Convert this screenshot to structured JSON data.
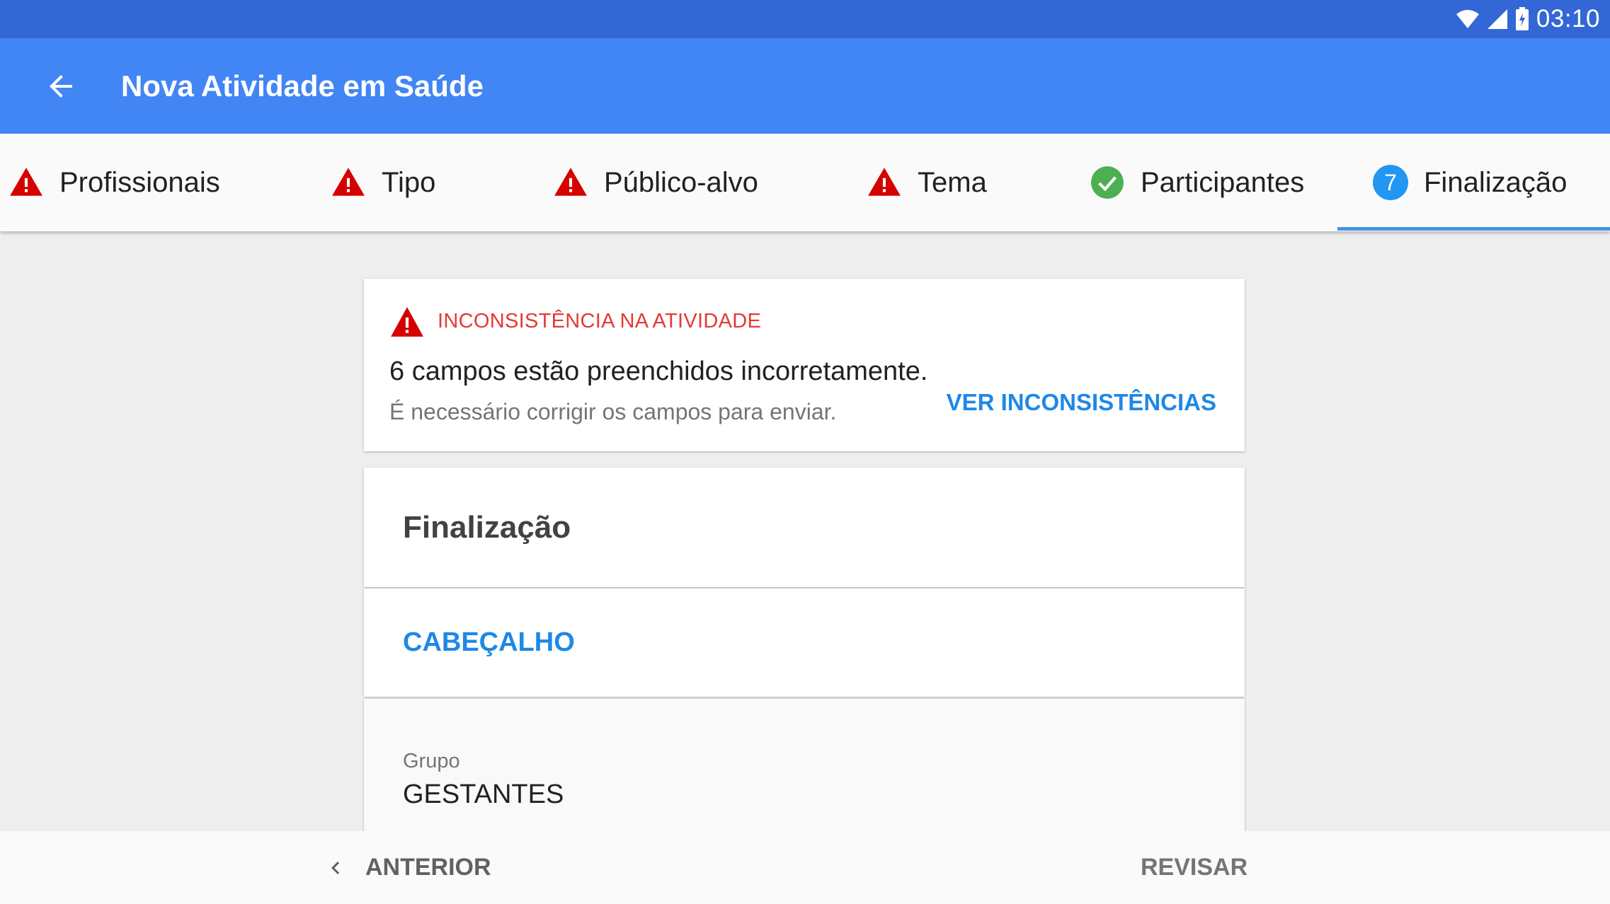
{
  "status_bar": {
    "time": "03:10",
    "icons": [
      "wifi-icon",
      "signal-icon",
      "battery-icon"
    ]
  },
  "app_bar": {
    "title": "Nova Atividade em Saúde",
    "back_icon": "arrow-back-icon"
  },
  "stepper": {
    "active_index": 5,
    "steps": [
      {
        "label": "Profissionais",
        "status": "error",
        "icon": "warning-icon"
      },
      {
        "label": "Tipo",
        "status": "error",
        "icon": "warning-icon"
      },
      {
        "label": "Público-alvo",
        "status": "error",
        "icon": "warning-icon"
      },
      {
        "label": "Tema",
        "status": "error",
        "icon": "warning-icon"
      },
      {
        "label": "Participantes",
        "status": "done",
        "icon": "check-circle-icon"
      },
      {
        "label": "Finalização",
        "status": "current",
        "number": "7"
      }
    ]
  },
  "alert": {
    "title": "INCONSISTÊNCIA NA ATIVIDADE",
    "message": "6 campos estão preenchidos incorretamente.",
    "subtext": "É necessário corrigir os campos para enviar.",
    "action_label": "VER INCONSISTÊNCIAS"
  },
  "section": {
    "title": "Finalização",
    "header_label": "CABEÇALHO",
    "field_label": "Grupo",
    "field_value": "GESTANTES"
  },
  "bottom_bar": {
    "prev_label": "ANTERIOR",
    "review_label": "REVISAR"
  },
  "colors": {
    "status_bar": "#3367d6",
    "app_bar": "#4285f4",
    "error": "#e53935",
    "success": "#4caf50",
    "accent": "#1e88e5"
  }
}
